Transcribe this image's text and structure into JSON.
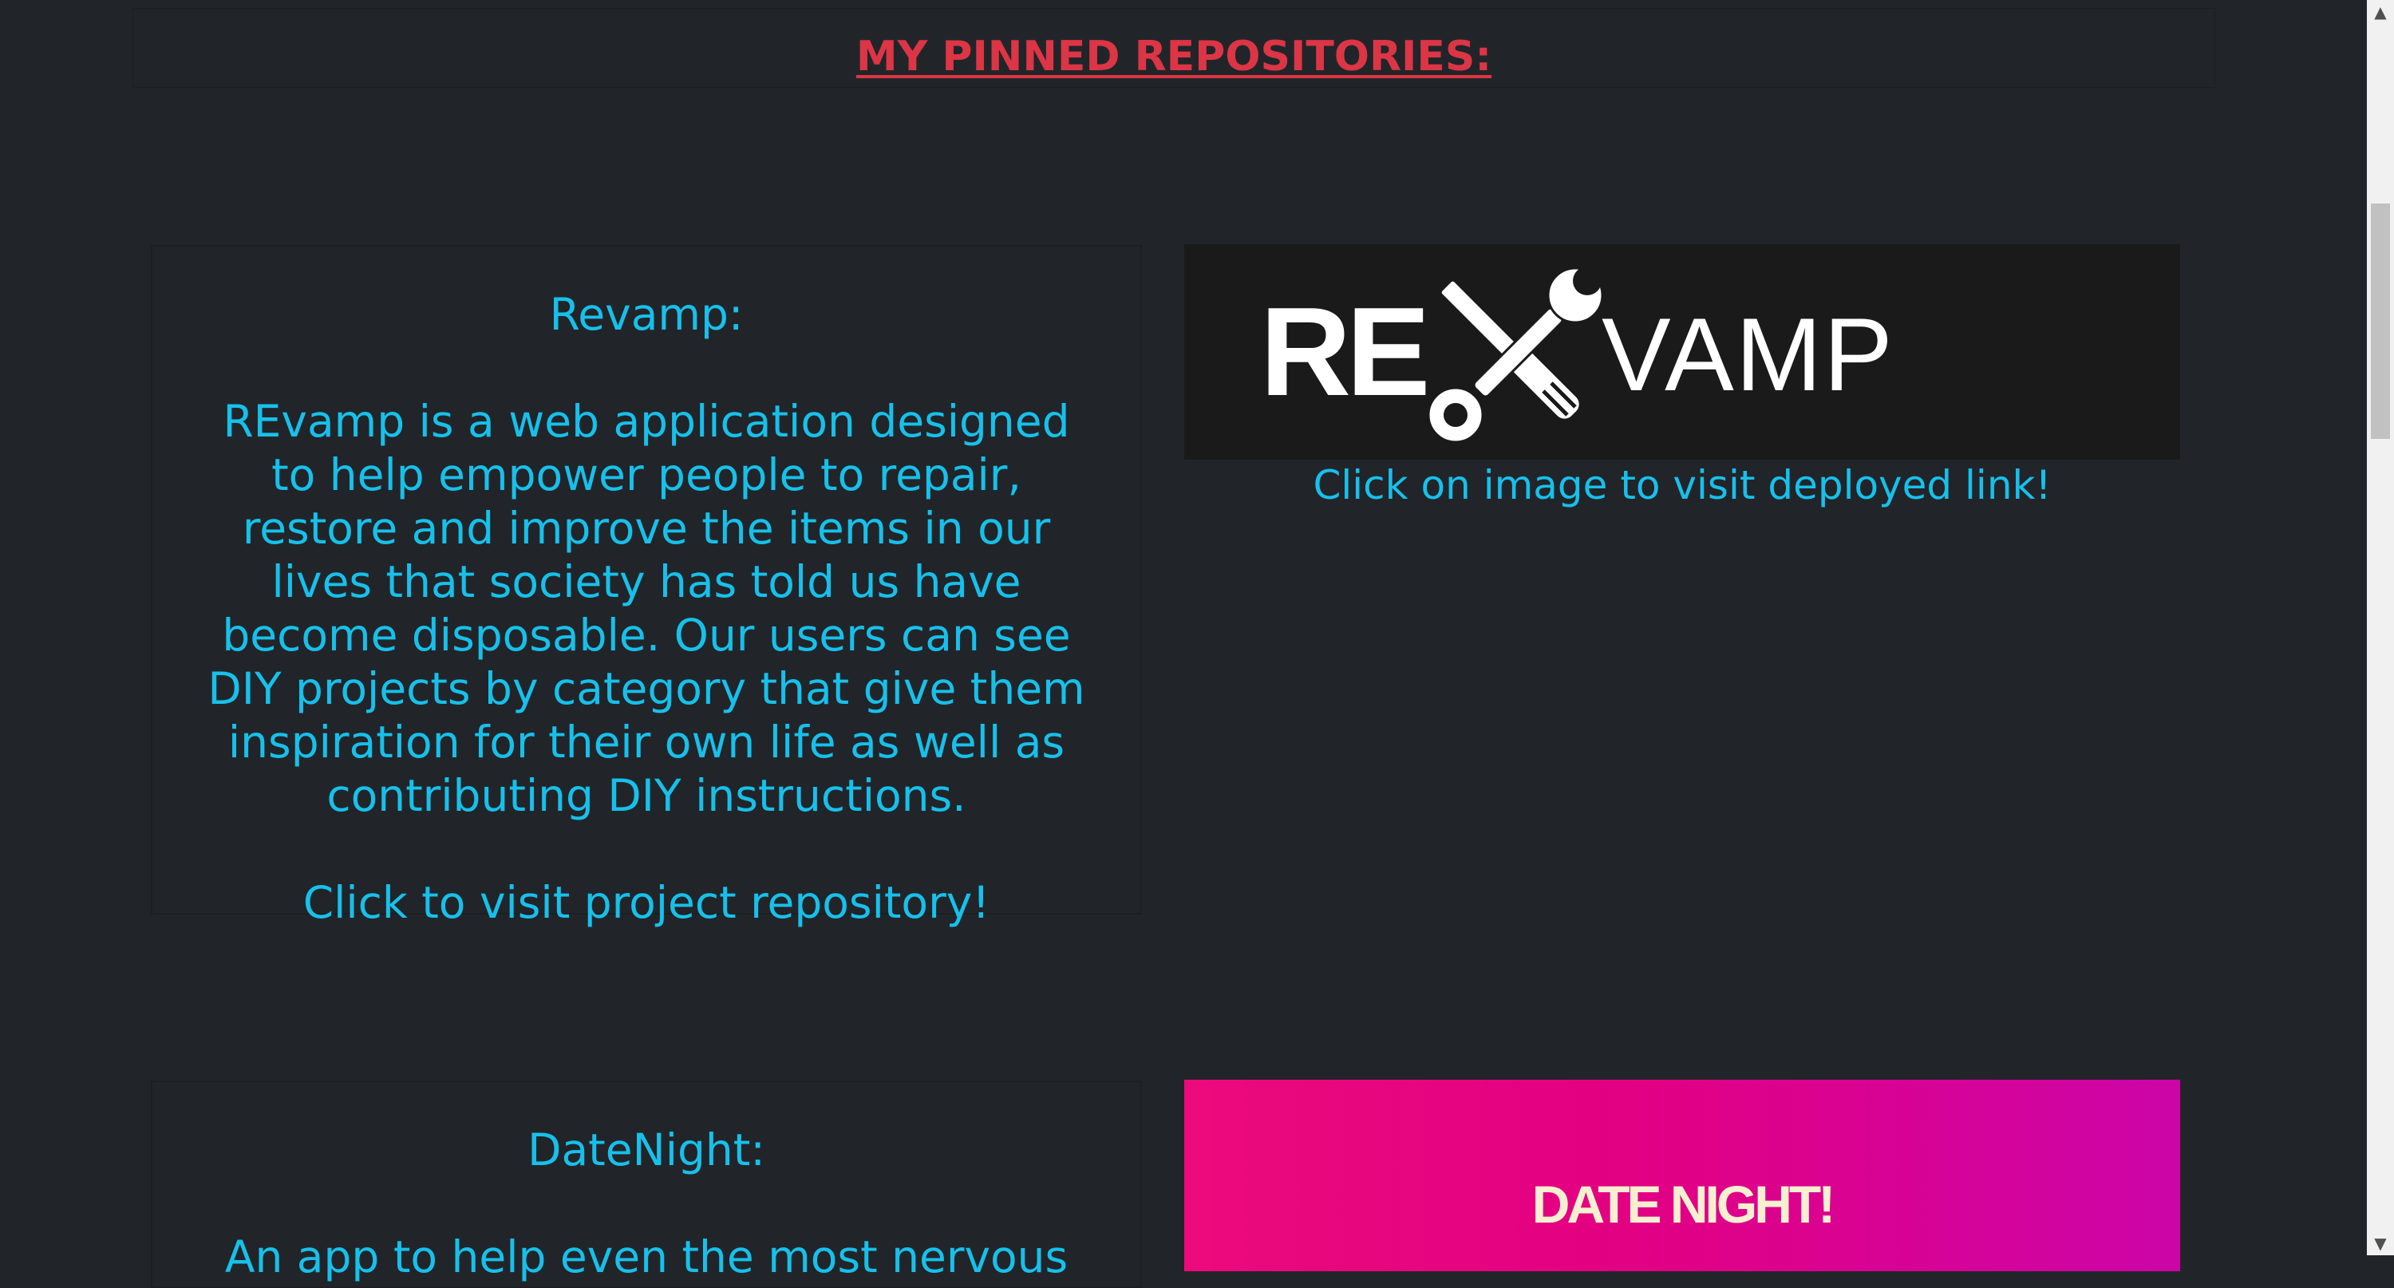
{
  "header": {
    "title": "MY PINNED REPOSITORIES:"
  },
  "projects": [
    {
      "title": "Revamp:",
      "description": "REvamp is a web application designed to help empower people to repair, restore and improve the items in our lives that society has told us have become disposable. Our users can see DIY projects by category that give them inspiration for their own life as well as contributing DIY instructions.",
      "repo_link": "Click to visit project repository!",
      "image": {
        "logo_left": "RE",
        "logo_right": "VAMP",
        "icon": "screwdriver-wrench-icon"
      },
      "caption": "Click on image to visit deployed link!"
    },
    {
      "title": "DateNight:",
      "description": "An app to help even the most nervous",
      "image": {
        "logo": "DATE NIGHT!"
      }
    }
  ],
  "scrollbar": {
    "up_icon": "▲",
    "down_icon": "▼"
  },
  "colors": {
    "background": "#212529",
    "heading": "#dc3545",
    "text": "#17c0eb"
  }
}
